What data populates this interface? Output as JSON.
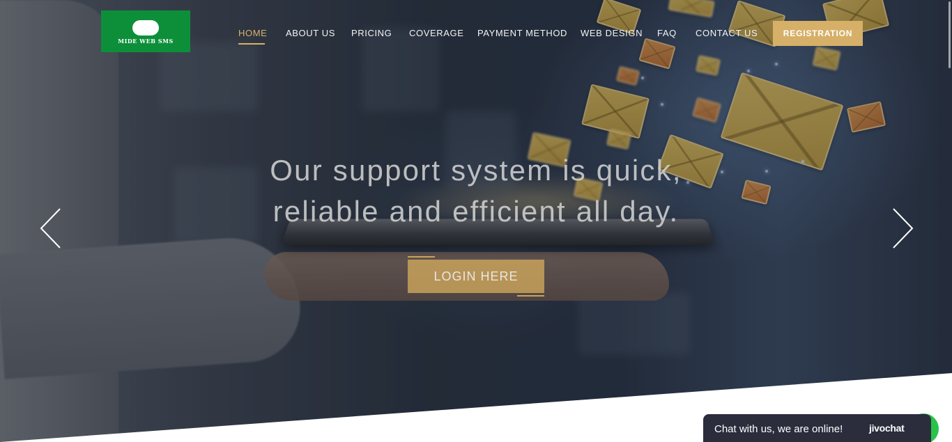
{
  "brand": {
    "logo_text": "MIDE WEB SMS"
  },
  "nav": {
    "items": [
      {
        "label": "HOME",
        "active": true
      },
      {
        "label": "ABOUT US",
        "active": false
      },
      {
        "label": "PRICING",
        "active": false
      },
      {
        "label": "COVERAGE",
        "active": false
      },
      {
        "label": "PAYMENT METHOD",
        "active": false
      },
      {
        "label": "WEB DESIGN",
        "active": false
      },
      {
        "label": "FAQ",
        "active": false
      },
      {
        "label": "CONTACT US",
        "active": false
      }
    ],
    "registration_label": "REGISTRATION"
  },
  "hero": {
    "headline_line1": "Our support system is quick,",
    "headline_line2": "reliable and efficient all day.",
    "cta_label": "LOGIN HERE",
    "prev_icon": "chevron-left-icon",
    "next_icon": "chevron-right-icon"
  },
  "chat": {
    "message": "Chat with us, we are online!",
    "brand": "jivochat"
  },
  "colors": {
    "accent_gold": "#d6b068",
    "logo_green": "#0d8f3a",
    "chat_bg": "#2b2d3d",
    "chat_green": "#29c34a"
  }
}
